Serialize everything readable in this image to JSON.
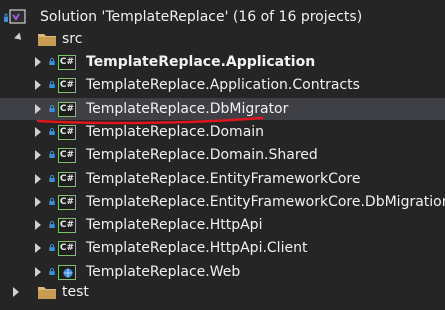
{
  "solution": {
    "label": "Solution 'TemplateReplace' (16 of 16 projects)"
  },
  "folders": [
    {
      "label": "src",
      "expanded": true
    },
    {
      "label": "test",
      "expanded": false
    }
  ],
  "projects": [
    {
      "label": "TemplateReplace.Application",
      "icon": "csharp-project-icon",
      "bold": true
    },
    {
      "label": "TemplateReplace.Application.Contracts",
      "icon": "csharp-project-icon"
    },
    {
      "label": "TemplateReplace.DbMigrator",
      "icon": "csharp-project-icon",
      "selected": true
    },
    {
      "label": "TemplateReplace.Domain",
      "icon": "csharp-project-icon"
    },
    {
      "label": "TemplateReplace.Domain.Shared",
      "icon": "csharp-project-icon"
    },
    {
      "label": "TemplateReplace.EntityFrameworkCore",
      "icon": "csharp-project-icon"
    },
    {
      "label": "TemplateReplace.EntityFrameworkCore.DbMigrations",
      "icon": "csharp-project-icon"
    },
    {
      "label": "TemplateReplace.HttpApi",
      "icon": "csharp-project-icon"
    },
    {
      "label": "TemplateReplace.HttpApi.Client",
      "icon": "csharp-project-icon"
    },
    {
      "label": "TemplateReplace.Web",
      "icon": "web-project-icon"
    }
  ],
  "csharp_icon_text": "C#",
  "colors": {
    "background": "#252526",
    "selection": "#3f3f46",
    "lock": "#3c8fd8",
    "project_border": "#7fbf6f",
    "folder": "#dcb67a",
    "annotation_underline": "#e0161e"
  }
}
